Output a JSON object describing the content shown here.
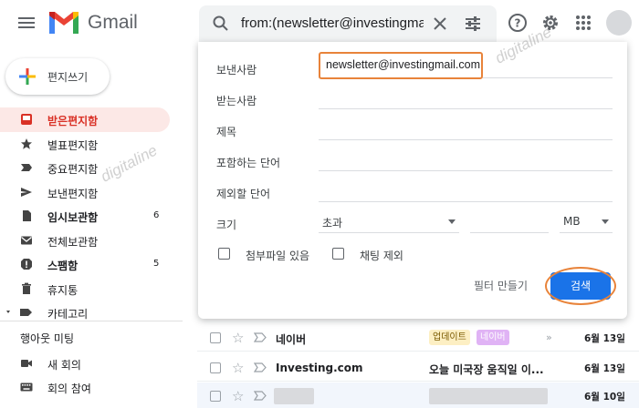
{
  "header": {
    "brand": "Gmail",
    "search_query": "from:(newsletter@investingmail.c"
  },
  "sidebar": {
    "compose_label": "편지쓰기",
    "items": [
      {
        "label": "받은편지함",
        "count": "",
        "icon": "inbox-icon",
        "active": true
      },
      {
        "label": "별표편지함",
        "count": "",
        "icon": "star-icon"
      },
      {
        "label": "중요편지함",
        "count": "",
        "icon": "important-label-icon"
      },
      {
        "label": "보낸편지함",
        "count": "",
        "icon": "send-icon"
      },
      {
        "label": "임시보관함",
        "count": "6",
        "icon": "draft-icon",
        "bold": true
      },
      {
        "label": "전체보관함",
        "count": "",
        "icon": "mail-icon"
      },
      {
        "label": "스팸함",
        "count": "5",
        "icon": "spam-icon",
        "bold": true
      },
      {
        "label": "휴지통",
        "count": "",
        "icon": "trash-icon"
      },
      {
        "label": "카테고리",
        "count": "",
        "icon": "label-icon"
      }
    ],
    "meet": {
      "title": "행아웃 미팅",
      "new_meeting": "새 회의",
      "join_meeting": "회의 참여"
    }
  },
  "advanced_search": {
    "from_label": "보낸사람",
    "from_value": "newsletter@investingmail.com",
    "to_label": "받는사람",
    "subject_label": "제목",
    "has_words_label": "포함하는 단어",
    "doesnt_have_label": "제외할 단어",
    "size_label": "크기",
    "size_operator": "초과",
    "size_unit": "MB",
    "has_attachment_label": "첨부파일 있음",
    "exclude_chats_label": "채팅 제외",
    "create_filter_label": "필터 만들기",
    "search_button_label": "검색"
  },
  "mail_rows": [
    {
      "sender": "네이버",
      "badges": [
        "업데이트",
        "네이버"
      ],
      "snippet": "",
      "date": "6월 13일"
    },
    {
      "sender": "Investing.com",
      "badges": [],
      "snippet": "오늘 미국장 움직일 이...",
      "date": "6월 13일"
    },
    {
      "sender": "",
      "badges": [],
      "snippet": "",
      "date": "6월 10일"
    }
  ],
  "watermark": "digitaline",
  "colors": {
    "accent": "#1a73e8",
    "active_nav_bg": "#fce8e6",
    "active_nav_text": "#d93025",
    "highlight_outline": "#e8833a",
    "update_badge": "#fdefc3",
    "naver_badge": "#e0b3f5"
  }
}
